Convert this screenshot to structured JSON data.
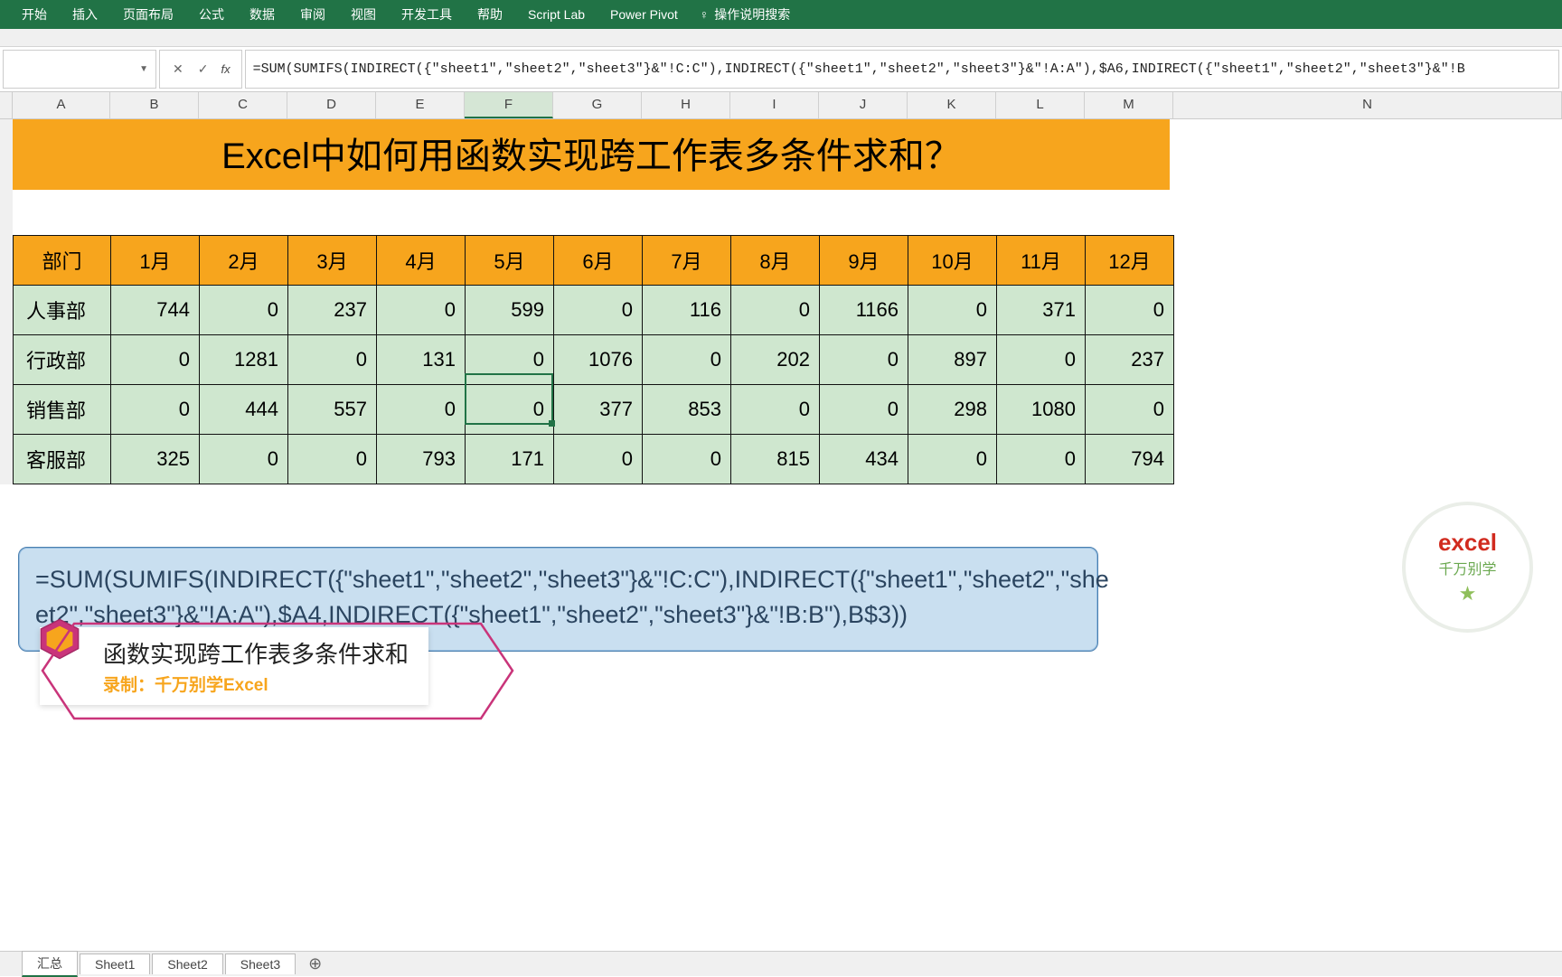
{
  "ribbon": {
    "tabs": [
      "开始",
      "插入",
      "页面布局",
      "公式",
      "数据",
      "审阅",
      "视图",
      "开发工具",
      "帮助",
      "Script Lab",
      "Power Pivot"
    ],
    "tell_me": "操作说明搜索"
  },
  "namebox": {
    "value": ""
  },
  "formula_bar": "=SUM(SUMIFS(INDIRECT({\"sheet1\",\"sheet2\",\"sheet3\"}&\"!C:C\"),INDIRECT({\"sheet1\",\"sheet2\",\"sheet3\"}&\"!A:A\"),$A6,INDIRECT({\"sheet1\",\"sheet2\",\"sheet3\"}&\"!B",
  "columns": [
    "A",
    "B",
    "C",
    "D",
    "E",
    "F",
    "G",
    "H",
    "I",
    "J",
    "K",
    "L",
    "M",
    "N"
  ],
  "selected_column": "F",
  "title": "Excel中如何用函数实现跨工作表多条件求和？",
  "table": {
    "dept_header": "部门",
    "months": [
      "1月",
      "2月",
      "3月",
      "4月",
      "5月",
      "6月",
      "7月",
      "8月",
      "9月",
      "10月",
      "11月",
      "12月"
    ],
    "rows": [
      {
        "dept": "人事部",
        "vals": [
          "744",
          "0",
          "237",
          "0",
          "599",
          "0",
          "116",
          "0",
          "1166",
          "0",
          "371",
          "0"
        ]
      },
      {
        "dept": "行政部",
        "vals": [
          "0",
          "1281",
          "0",
          "131",
          "0",
          "1076",
          "0",
          "202",
          "0",
          "897",
          "0",
          "237"
        ]
      },
      {
        "dept": "销售部",
        "vals": [
          "0",
          "444",
          "557",
          "0",
          "0",
          "377",
          "853",
          "0",
          "0",
          "298",
          "1080",
          "0"
        ]
      },
      {
        "dept": "客服部",
        "vals": [
          "325",
          "0",
          "0",
          "793",
          "171",
          "0",
          "0",
          "815",
          "434",
          "0",
          "0",
          "794"
        ]
      }
    ]
  },
  "callout": "=SUM(SUMIFS(INDIRECT({\"sheet1\",\"sheet2\",\"sheet3\"}&\"!C:C\"),INDIRECT({\"sheet1\",\"sheet2\",\"she\net2\",\"sheet3\"}&\"!A:A\"),$A4,INDIRECT({\"sheet1\",\"sheet2\",\"sheet3\"}&\"!B:B\"),B$3))",
  "lower_banner": {
    "title": "函数实现跨工作表多条件求和",
    "sub": "录制：千万别学Excel"
  },
  "logo": {
    "line1": "excel",
    "line2": "千万别学"
  },
  "sheet_tabs": {
    "active": "汇总",
    "tabs": [
      "汇总",
      "Sheet1",
      "Sheet2",
      "Sheet3"
    ]
  },
  "chart_data": {
    "type": "table",
    "title": "Excel中如何用函数实现跨工作表多条件求和？",
    "columns": [
      "部门",
      "1月",
      "2月",
      "3月",
      "4月",
      "5月",
      "6月",
      "7月",
      "8月",
      "9月",
      "10月",
      "11月",
      "12月"
    ],
    "rows": [
      [
        "人事部",
        744,
        0,
        237,
        0,
        599,
        0,
        116,
        0,
        1166,
        0,
        371,
        0
      ],
      [
        "行政部",
        0,
        1281,
        0,
        131,
        0,
        1076,
        0,
        202,
        0,
        897,
        0,
        237
      ],
      [
        "销售部",
        0,
        444,
        557,
        0,
        0,
        377,
        853,
        0,
        0,
        298,
        1080,
        0
      ],
      [
        "客服部",
        325,
        0,
        0,
        793,
        171,
        0,
        0,
        815,
        434,
        0,
        0,
        794
      ]
    ]
  }
}
